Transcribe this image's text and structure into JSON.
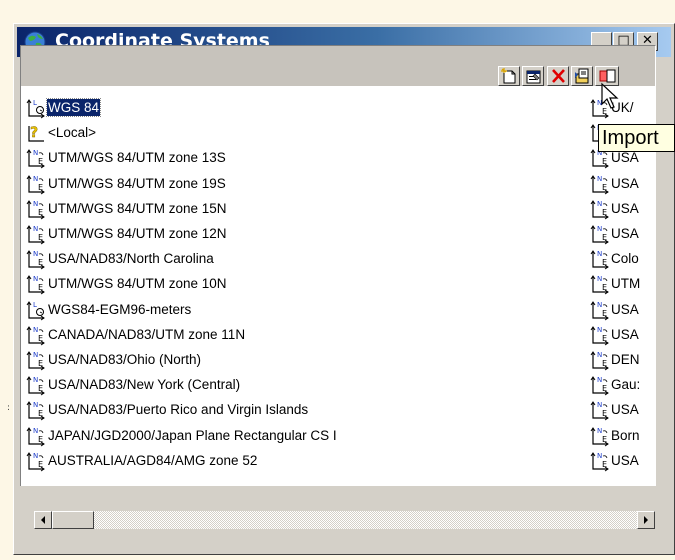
{
  "window": {
    "title": "Coordinate Systems",
    "title_icon": "globe-icon",
    "controls": {
      "minimize_label": "_",
      "maximize_label": "□",
      "close_label": "✕"
    }
  },
  "toolbar": {
    "buttons": [
      {
        "name": "new-icon"
      },
      {
        "name": "properties-icon"
      },
      {
        "name": "delete-icon"
      },
      {
        "name": "import-icon"
      },
      {
        "name": "copy-icon"
      }
    ]
  },
  "tooltip": {
    "text": "Import"
  },
  "list": {
    "items": [
      {
        "label": "WGS 84",
        "icon": "latlong-icon",
        "selected": true
      },
      {
        "label": "<Local>",
        "icon": "local-icon"
      },
      {
        "label": "UTM/WGS 84/UTM zone 13S",
        "icon": "northing-easting-icon"
      },
      {
        "label": "UTM/WGS 84/UTM zone 19S",
        "icon": "northing-easting-icon"
      },
      {
        "label": "UTM/WGS 84/UTM zone 15N",
        "icon": "northing-easting-icon"
      },
      {
        "label": "UTM/WGS 84/UTM zone 12N",
        "icon": "northing-easting-icon"
      },
      {
        "label": "USA/NAD83/North Carolina",
        "icon": "northing-easting-icon"
      },
      {
        "label": "UTM/WGS 84/UTM zone 10N",
        "icon": "northing-easting-icon"
      },
      {
        "label": "WGS84-EGM96-meters",
        "icon": "latlong-icon"
      },
      {
        "label": "CANADA/NAD83/UTM zone 11N",
        "icon": "northing-easting-icon"
      },
      {
        "label": "USA/NAD83/Ohio (North)",
        "icon": "northing-easting-icon"
      },
      {
        "label": "USA/NAD83/New York (Central)",
        "icon": "northing-easting-icon"
      },
      {
        "label": "USA/NAD83/Puerto Rico and Virgin Islands",
        "icon": "northing-easting-icon"
      },
      {
        "label": "JAPAN/JGD2000/Japan Plane Rectangular CS I",
        "icon": "northing-easting-icon"
      },
      {
        "label": "AUSTRALIA/AGD84/AMG zone 52",
        "icon": "northing-easting-icon"
      }
    ],
    "right_column": [
      "UK/",
      "",
      "USA",
      "USA",
      "USA",
      "USA",
      "Colo",
      "UTM",
      "USA",
      "USA",
      "DEN",
      "Gau:",
      "USA",
      "Born",
      "USA"
    ]
  },
  "scrollbar": {
    "left_arrow": "◄",
    "right_arrow": "►"
  },
  "stray_mark": ":"
}
